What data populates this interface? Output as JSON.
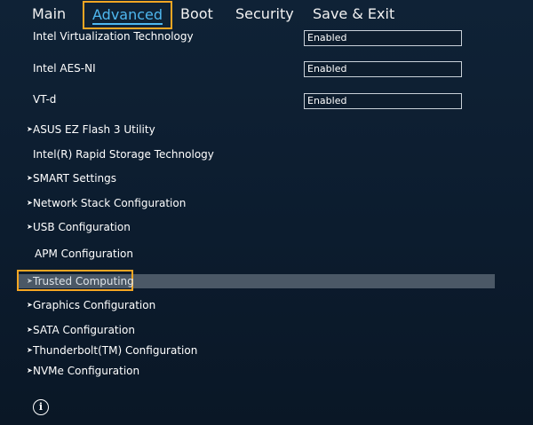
{
  "tabs": [
    {
      "label": "Main"
    },
    {
      "label": "Advanced"
    },
    {
      "label": "Boot"
    },
    {
      "label": "Security"
    },
    {
      "label": "Save & Exit"
    }
  ],
  "active_tab": "Advanced",
  "settings": [
    {
      "label": "Intel Virtualization Technology",
      "value": "Enabled"
    },
    {
      "label": "Intel AES-NI",
      "value": "Enabled"
    },
    {
      "label": "VT-d",
      "value": "Enabled"
    }
  ],
  "menu_items": [
    {
      "label": "ASUS EZ Flash 3 Utility",
      "submenu": true
    },
    {
      "label": "Intel(R) Rapid Storage Technology",
      "submenu": false
    },
    {
      "label": "SMART Settings",
      "submenu": true
    },
    {
      "label": "Network Stack Configuration",
      "submenu": true
    },
    {
      "label": "USB Configuration",
      "submenu": true
    },
    {
      "label": "APM Configuration",
      "submenu": false
    },
    {
      "label": "Trusted Computing",
      "submenu": true,
      "selected": true
    },
    {
      "label": "Graphics Configuration",
      "submenu": true
    },
    {
      "label": "SATA Configuration",
      "submenu": true
    },
    {
      "label": "Thunderbolt(TM) Configuration",
      "submenu": true
    },
    {
      "label": "NVMe Configuration",
      "submenu": true
    }
  ],
  "arrow_glyph": "➤",
  "info_glyph": "i",
  "colors": {
    "highlight_outline": "#f5a623",
    "active_tab_text": "#4fb8f0",
    "selected_row_bg": "#4b5866"
  }
}
